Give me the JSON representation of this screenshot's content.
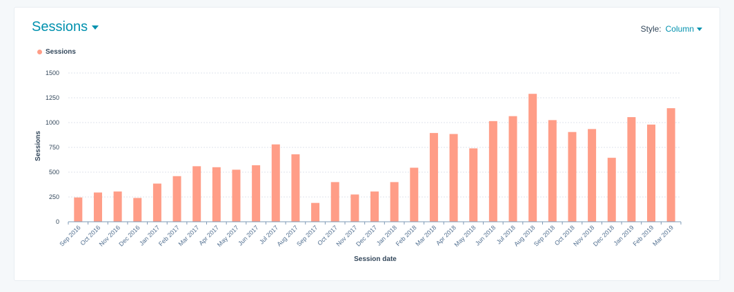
{
  "card": {
    "title": "Sessions",
    "style_label": "Style:",
    "style_value": "Column"
  },
  "colors": {
    "accent": "#0091ae",
    "bar": "#ff9d87",
    "text": "#33475b",
    "grid": "#dfe3eb"
  },
  "chart_data": {
    "type": "bar",
    "title": "",
    "xlabel": "Session date",
    "ylabel": "Sessions",
    "ylim": [
      0,
      1500
    ],
    "yticks": [
      0,
      250,
      500,
      750,
      1000,
      1250,
      1500
    ],
    "legend": "top-left",
    "grid": true,
    "categories": [
      "Sep 2016",
      "Oct 2016",
      "Nov 2016",
      "Dec 2016",
      "Jan 2017",
      "Feb 2017",
      "Mar 2017",
      "Apr 2017",
      "May 2017",
      "Jun 2017",
      "Jul 2017",
      "Aug 2017",
      "Sep 2017",
      "Oct 2017",
      "Nov 2017",
      "Dec 2017",
      "Jan 2018",
      "Feb 2018",
      "Mar 2018",
      "Apr 2018",
      "May 2018",
      "Jun 2018",
      "Jul 2018",
      "Aug 2018",
      "Sep 2018",
      "Oct 2018",
      "Nov 2018",
      "Dec 2018",
      "Jan 2019",
      "Feb 2019",
      "Mar 2019"
    ],
    "series": [
      {
        "name": "Sessions",
        "values": [
          245,
          295,
          305,
          240,
          385,
          460,
          560,
          550,
          525,
          570,
          780,
          680,
          190,
          400,
          275,
          305,
          400,
          545,
          895,
          885,
          740,
          1015,
          1065,
          1290,
          1025,
          905,
          935,
          645,
          1055,
          980,
          1145
        ]
      }
    ]
  }
}
